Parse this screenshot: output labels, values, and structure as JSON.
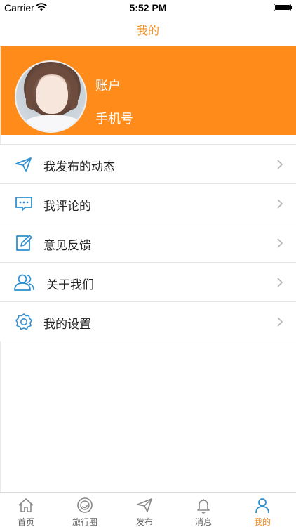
{
  "status_bar": {
    "carrier": "Carrier",
    "time": "5:52 PM"
  },
  "nav": {
    "title": "我的"
  },
  "profile": {
    "account_label": "账户",
    "phone_label": "手机号"
  },
  "menu": [
    {
      "label": "我发布的动态",
      "icon": "paper-plane-icon"
    },
    {
      "label": "我评论的",
      "icon": "comment-icon"
    },
    {
      "label": "意见反馈",
      "icon": "edit-icon"
    },
    {
      "label": "关于我们",
      "icon": "users-icon"
    },
    {
      "label": "我的设置",
      "icon": "settings-icon"
    }
  ],
  "tabs": [
    {
      "label": "首页",
      "icon": "home-icon"
    },
    {
      "label": "旅行圈",
      "icon": "circle-icon"
    },
    {
      "label": "发布",
      "icon": "send-icon"
    },
    {
      "label": "消息",
      "icon": "bell-icon"
    },
    {
      "label": "我的",
      "icon": "person-icon",
      "active": true
    }
  ],
  "colors": {
    "accent": "#ff8c1a",
    "icon_blue": "#2f8fd0",
    "tab_active": "#f08a1c"
  }
}
